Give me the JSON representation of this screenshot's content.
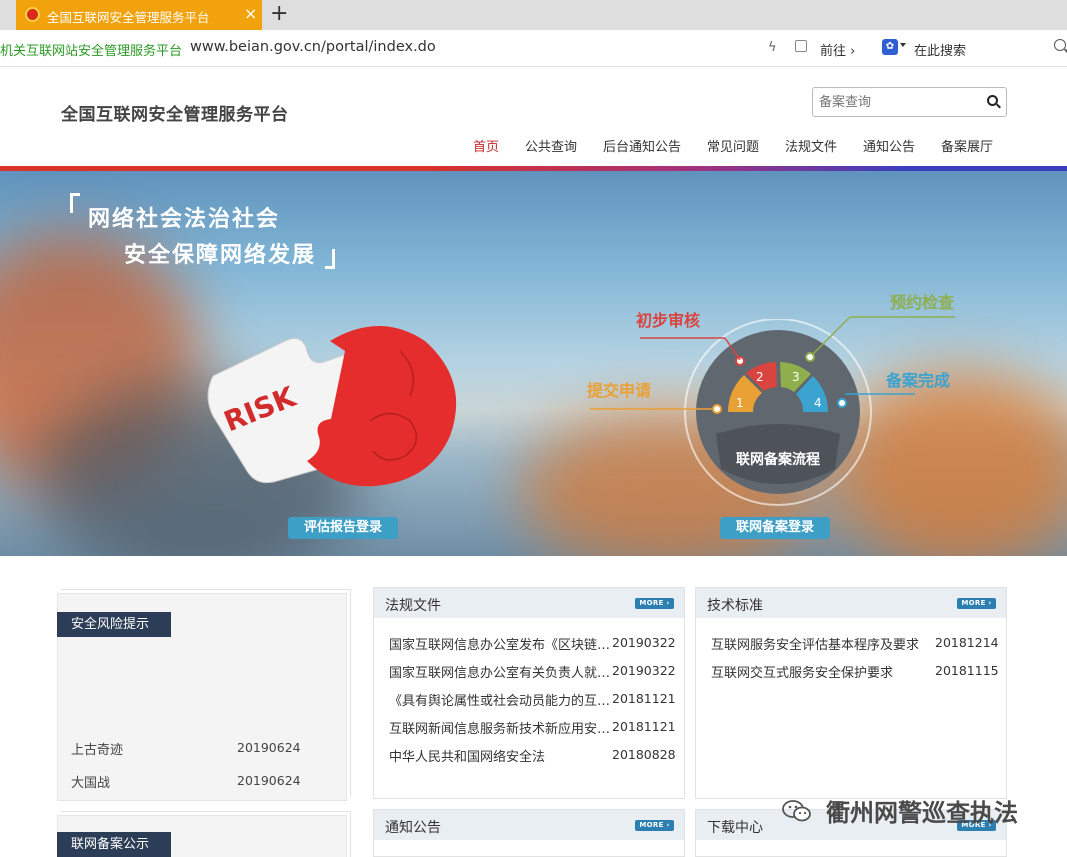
{
  "browser": {
    "tab_title": "全国互联网安全管理服务平台",
    "tab_close": "×",
    "new_tab": "+",
    "site_name": "机关互联网站安全管理服务平台",
    "url": "www.beian.gov.cn/portal/index.do",
    "goto_label": "前往 ›",
    "search_here": "在此搜索"
  },
  "header": {
    "title": "全国互联网安全管理服务平台",
    "search_placeholder": "备案查询"
  },
  "nav": {
    "items": [
      {
        "label": "首页",
        "active": true
      },
      {
        "label": "公共查询"
      },
      {
        "label": "后台通知公告"
      },
      {
        "label": "常见问题"
      },
      {
        "label": "法规文件"
      },
      {
        "label": "通知公告"
      },
      {
        "label": "备案展厅"
      }
    ]
  },
  "banner": {
    "slogan_line1": "网络社会法治社会",
    "slogan_line2": "安全保障网络发展",
    "risk_text": "RISK",
    "flow_title": "联网备案流程",
    "steps": [
      {
        "num": "1",
        "label": "提交申请",
        "color": "#e9a034"
      },
      {
        "num": "2",
        "label": "初步审核",
        "color": "#d9443f"
      },
      {
        "num": "3",
        "label": "预约检查",
        "color": "#8fae4c"
      },
      {
        "num": "4",
        "label": "备案完成",
        "color": "#3aa3cf"
      }
    ],
    "btn_assessment": "评估报告登录",
    "btn_filing": "联网备案登录"
  },
  "risk_panel": {
    "tag": "安全风险提示",
    "items": [
      {
        "title": "上古奇迹",
        "date": "20190624"
      },
      {
        "title": "大国战",
        "date": "20190624"
      }
    ]
  },
  "filing_panel": {
    "tag": "联网备案公示"
  },
  "laws": {
    "title": "法规文件",
    "more": "MORE ›",
    "items": [
      {
        "title": "国家互联网信息办公室发布《区块链信息服务管理规定》",
        "date": "20190322"
      },
      {
        "title": "国家互联网信息办公室有关负责人就《区块链信息服务管理规定》答记者问",
        "date": "20190322"
      },
      {
        "title": "《具有舆论属性或社会动员能力的互联网信息服务安全评估规定》",
        "date": "20181121"
      },
      {
        "title": "互联网新闻信息服务新技术新应用安全评估管理规定",
        "date": "20181121"
      },
      {
        "title": "中华人民共和国网络安全法",
        "date": "20180828"
      }
    ]
  },
  "standards": {
    "title": "技术标准",
    "more": "MORE ›",
    "items": [
      {
        "title": "互联网服务安全评估基本程序及要求",
        "date": "20181214"
      },
      {
        "title": "互联网交互式服务安全保护要求",
        "date": "20181115"
      }
    ]
  },
  "notices": {
    "title": "通知公告",
    "more": "MORE ›"
  },
  "downloads": {
    "title": "下载中心",
    "more": "MORE ›"
  },
  "watermark": {
    "text": "衢州网警巡查执法"
  }
}
